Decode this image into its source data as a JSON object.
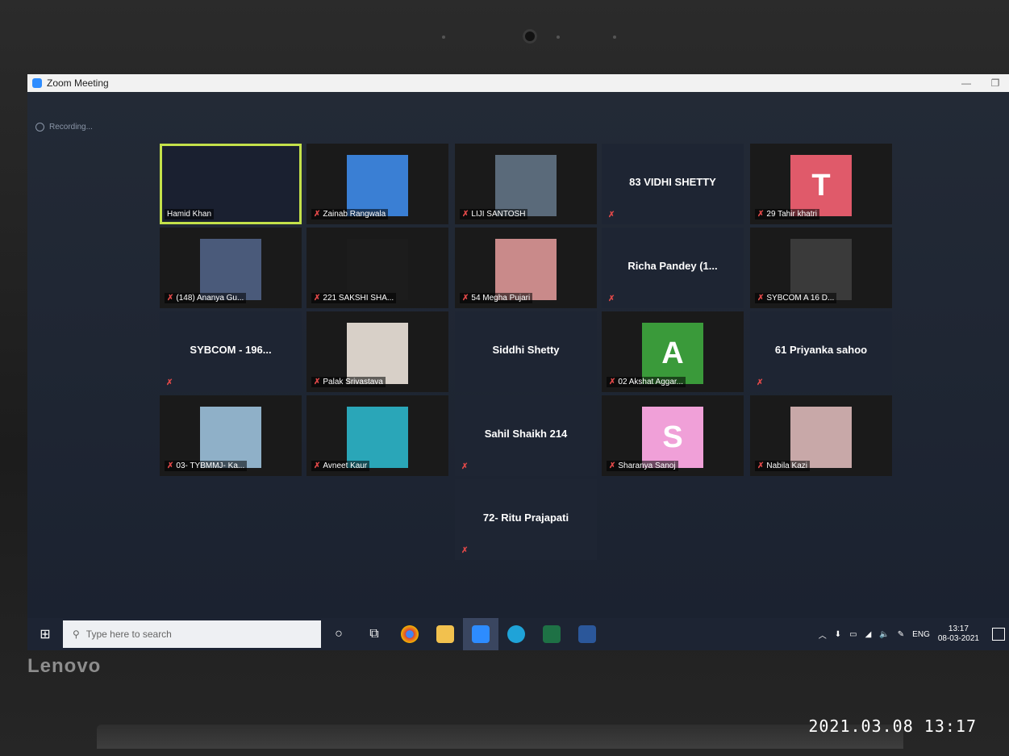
{
  "window": {
    "title": "Zoom Meeting",
    "minimize": "—",
    "restore": "❐",
    "recording_label": "Recording..."
  },
  "participants": [
    {
      "name": "Hamid Khan",
      "kind": "video",
      "active": true,
      "muted": false,
      "color": "#1a2030"
    },
    {
      "name": "Zainab Rangwala",
      "kind": "video",
      "muted": true,
      "color": "#3a7fd4"
    },
    {
      "name": "LIJI SANTOSH",
      "kind": "video",
      "muted": true,
      "color": "#5a6a7a"
    },
    {
      "name": "83 VIDHI SHETTY",
      "kind": "text",
      "muted": true
    },
    {
      "name": "29 Tahir khatri",
      "kind": "avatar",
      "letter": "T",
      "muted": true,
      "color": "#e05a6a"
    },
    {
      "name": "(148)  Ananya Gu...",
      "kind": "video",
      "muted": true,
      "color": "#4a5a7a"
    },
    {
      "name": "221 SAKSHI SHA...",
      "kind": "video",
      "muted": true,
      "color": "#1c1c1c"
    },
    {
      "name": "54 Megha Pujari",
      "kind": "video",
      "muted": true,
      "color": "#c98a8a"
    },
    {
      "name": "Richa Pandey (1...",
      "kind": "text",
      "muted": true
    },
    {
      "name": "SYBCOM A 16 D...",
      "kind": "video",
      "muted": true,
      "color": "#3a3a3a"
    },
    {
      "name": "SYBCOM - 196...",
      "kind": "text",
      "muted": true
    },
    {
      "name": "Palak Srivastava",
      "kind": "video",
      "muted": true,
      "color": "#d8d0c8"
    },
    {
      "name": "Siddhi Shetty",
      "kind": "text",
      "muted": false
    },
    {
      "name": "02 Akshat Aggar...",
      "kind": "avatar",
      "letter": "A",
      "muted": true,
      "color": "#3a9a3a"
    },
    {
      "name": "61 Priyanka sahoo",
      "kind": "text",
      "muted": true
    },
    {
      "name": "03- TYBMMJ- Ka...",
      "kind": "video",
      "muted": true,
      "color": "#8fb0c8"
    },
    {
      "name": "Avneet Kaur",
      "kind": "video",
      "muted": true,
      "color": "#2aa6b8"
    },
    {
      "name": "Sahil Shaikh 214",
      "kind": "text",
      "muted": true
    },
    {
      "name": "Sharanya Sanoj",
      "kind": "avatar",
      "letter": "S",
      "muted": true,
      "color": "#f0a0d8"
    },
    {
      "name": "Nabila Kazi",
      "kind": "video",
      "muted": true,
      "color": "#c8a8a8"
    },
    {
      "name": "72- Ritu Prajapati",
      "kind": "text",
      "muted": true
    }
  ],
  "taskbar": {
    "search_placeholder": "Type here to search",
    "language": "ENG",
    "time": "13:17",
    "date": "08-03-2021"
  },
  "device": {
    "brand": "Lenovo",
    "photo_timestamp": "2021.03.08 13:17"
  }
}
